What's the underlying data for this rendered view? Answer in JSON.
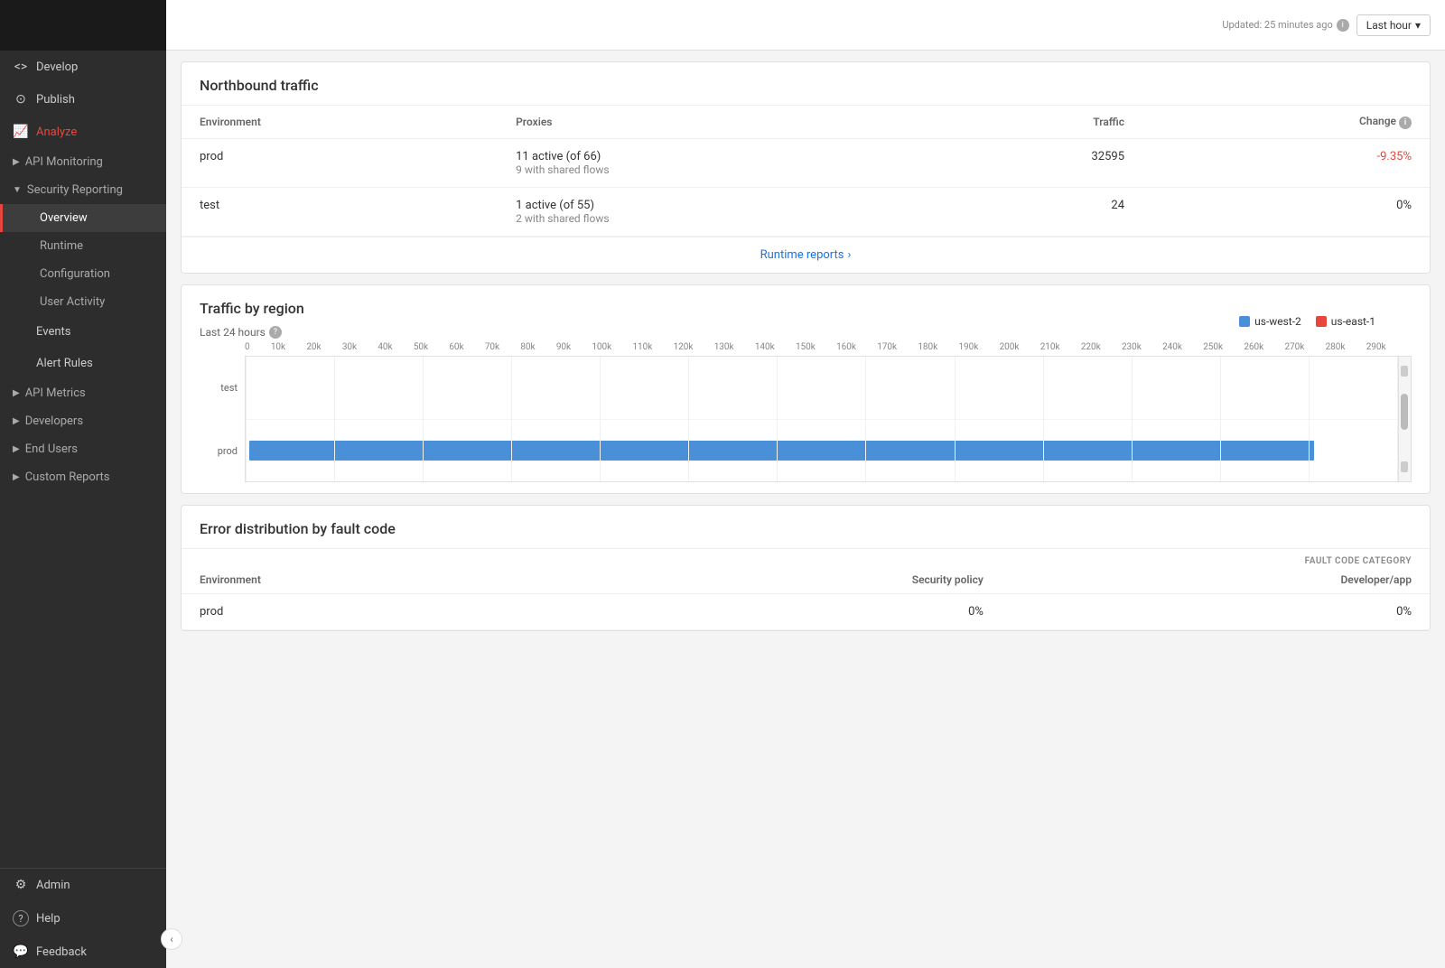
{
  "sidebar": {
    "topItems": [
      {
        "id": "develop",
        "label": "Develop",
        "icon": "<>"
      },
      {
        "id": "publish",
        "label": "Publish",
        "icon": "⊙"
      },
      {
        "id": "analyze",
        "label": "Analyze",
        "icon": "📊",
        "active": true
      }
    ],
    "sections": {
      "apiMonitoring": {
        "label": "API Monitoring",
        "expanded": false
      },
      "securityReporting": {
        "label": "Security Reporting",
        "expanded": true,
        "subItems": [
          {
            "id": "overview",
            "label": "Overview",
            "active": true
          },
          {
            "id": "runtime",
            "label": "Runtime"
          },
          {
            "id": "configuration",
            "label": "Configuration"
          },
          {
            "id": "userActivity",
            "label": "User Activity"
          }
        ]
      },
      "events": {
        "label": "Events"
      },
      "alertRules": {
        "label": "Alert Rules"
      },
      "apiMetrics": {
        "label": "API Metrics",
        "expanded": false
      },
      "developers": {
        "label": "Developers",
        "expanded": false
      },
      "endUsers": {
        "label": "End Users",
        "expanded": false
      },
      "customReports": {
        "label": "Custom Reports",
        "expanded": false
      }
    },
    "bottomItems": [
      {
        "id": "admin",
        "label": "Admin",
        "icon": "⚙"
      },
      {
        "id": "help",
        "label": "Help",
        "icon": "?"
      },
      {
        "id": "feedback",
        "label": "Feedback",
        "icon": "💬"
      }
    ]
  },
  "header": {
    "updateText": "Updated: 25 minutes ago",
    "infoIcon": "ℹ",
    "timeFilter": "Last hour",
    "chevron": "▾"
  },
  "northbound": {
    "title": "Northbound traffic",
    "columns": {
      "environment": "Environment",
      "proxies": "Proxies",
      "traffic": "Traffic",
      "change": "Change"
    },
    "rows": [
      {
        "env": "prod",
        "proxies": "11 active (of 66)",
        "proxiesDetail": "9 with shared flows",
        "traffic": "32595",
        "change": "-9.35%",
        "changeClass": "negative"
      },
      {
        "env": "test",
        "proxies": "1 active (of 55)",
        "proxiesDetail": "2 with shared flows",
        "traffic": "24",
        "change": "0%",
        "changeClass": ""
      }
    ],
    "runtimeLink": "Runtime reports",
    "chevron": "›"
  },
  "trafficByRegion": {
    "title": "Traffic by region",
    "subtitle": "Last 24 hours",
    "infoIcon": "?",
    "legend": [
      {
        "label": "us-west-2",
        "color": "#4a90d9"
      },
      {
        "label": "us-east-1",
        "color": "#e8463c"
      }
    ],
    "xLabels": [
      "0",
      "10k",
      "20k",
      "30k",
      "40k",
      "50k",
      "60k",
      "70k",
      "80k",
      "90k",
      "100k",
      "110k",
      "120k",
      "130k",
      "140k",
      "150k",
      "160k",
      "170k",
      "180k",
      "190k",
      "200k",
      "210k",
      "220k",
      "230k",
      "240k",
      "250k",
      "260k",
      "270k",
      "280k",
      "290k"
    ],
    "rows": [
      {
        "label": "test",
        "barWidth": "0%",
        "color": "#4a90d9"
      },
      {
        "label": "prod",
        "barWidth": "93%",
        "color": "#4a90d9"
      }
    ]
  },
  "errorDistribution": {
    "title": "Error distribution by fault code",
    "categoryLabel": "FAULT CODE CATEGORY",
    "columns": {
      "environment": "Environment",
      "securityPolicy": "Security policy",
      "developerApp": "Developer/app"
    },
    "rows": [
      {
        "env": "prod",
        "securityPolicy": "0%",
        "developerApp": "0%"
      }
    ]
  }
}
